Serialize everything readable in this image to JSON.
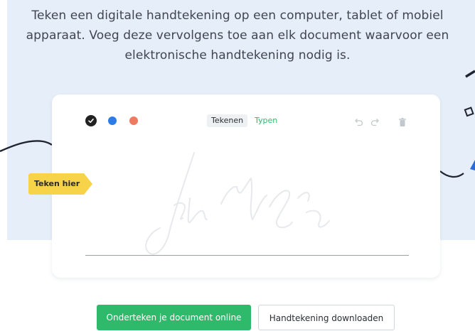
{
  "hero": {
    "line1": "Teken een digitale handtekening op een computer, tablet of mobiel",
    "line2": "apparaat. Voeg deze vervolgens toe aan elk document waarvoor een",
    "line3": "elektronische handtekening nodig is."
  },
  "signature_pad": {
    "colors": [
      {
        "name": "black",
        "hex": "#222222",
        "selected": true
      },
      {
        "name": "blue",
        "hex": "#2d7be5",
        "selected": false
      },
      {
        "name": "red",
        "hex": "#ef7a62",
        "selected": false
      }
    ],
    "tabs": [
      {
        "label": "Tekenen",
        "active": true
      },
      {
        "label": "Typen",
        "active": false
      }
    ],
    "tools": {
      "undo_icon": "undo-icon",
      "redo_icon": "redo-icon",
      "delete_icon": "trash-icon"
    },
    "sign_here_label": "Teken hier"
  },
  "actions": {
    "primary_label": "Onderteken je document online",
    "secondary_label": "Handtekening downloaden"
  },
  "colors": {
    "accent_green": "#2fb96a",
    "tag_yellow": "#f7d34a",
    "hero_background": "#e6eff9"
  }
}
